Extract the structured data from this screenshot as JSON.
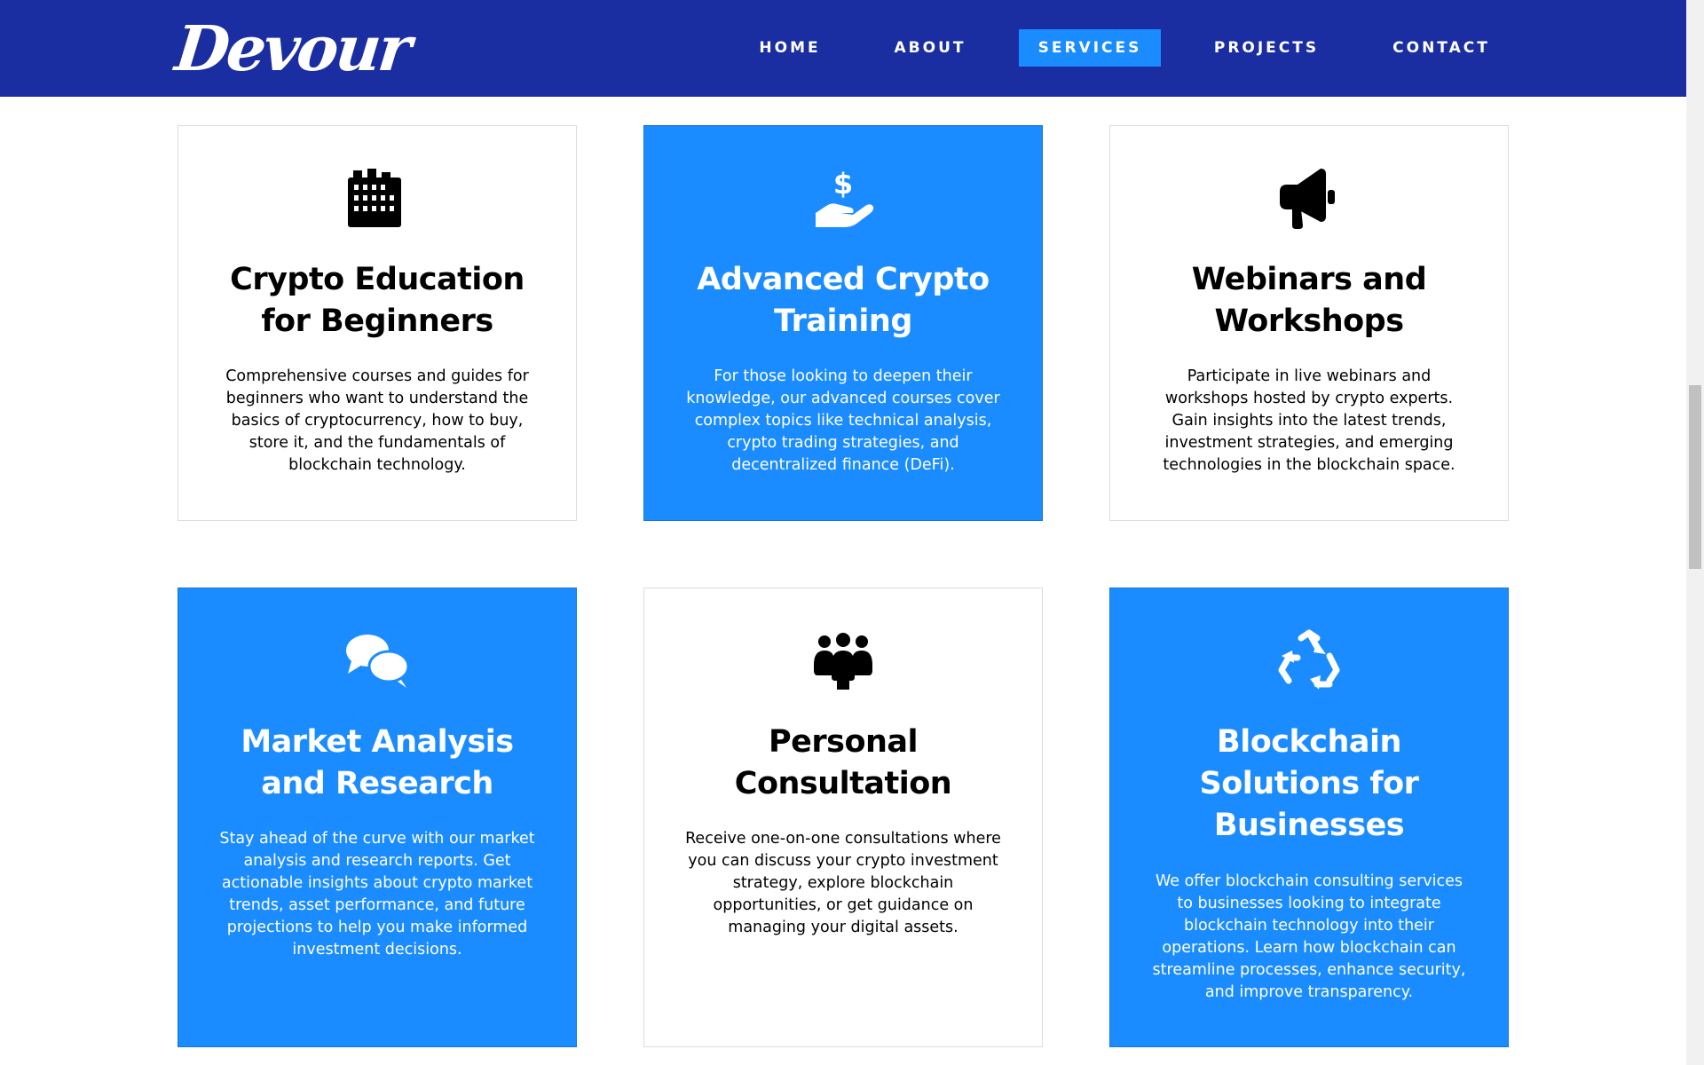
{
  "header": {
    "logo": "Devour",
    "nav": [
      "HOME",
      "ABOUT",
      "SERVICES",
      "PROJECTS",
      "CONTACT"
    ],
    "active_nav": "SERVICES"
  },
  "colors": {
    "header_bg": "#1a2ea1",
    "accent_blue": "#1a8cff",
    "card_border": "#dddddd"
  },
  "services": [
    {
      "icon": "building-icon",
      "title": "Crypto Education for Beginners",
      "description": "Comprehensive courses and guides for beginners who want to understand the basics of cryptocurrency, how to buy, store it, and the fundamentals of blockchain technology."
    },
    {
      "icon": "hand-dollar-icon",
      "title": "Advanced Crypto Training",
      "description": "For those looking to deepen their knowledge, our advanced courses cover complex topics like technical analysis, crypto trading strategies, and decentralized finance (DeFi)."
    },
    {
      "icon": "megaphone-icon",
      "title": "Webinars and Workshops",
      "description": "Participate in live webinars and workshops hosted by crypto experts. Gain insights into the latest trends, investment strategies, and emerging technologies in the blockchain space."
    },
    {
      "icon": "comments-icon",
      "title": "Market Analysis and Research",
      "description": "Stay ahead of the curve with our market analysis and research reports. Get actionable insights about crypto market trends, asset performance, and future projections to help you make informed investment decisions."
    },
    {
      "icon": "users-icon",
      "title": "Personal Consultation",
      "description": "Receive one-on-one consultations where you can discuss your crypto investment strategy, explore blockchain opportunities, or get guidance on managing your digital assets."
    },
    {
      "icon": "recycle-icon",
      "title": "Blockchain Solutions for Businesses",
      "description": "We offer blockchain consulting services to businesses looking to integrate blockchain technology into their operations. Learn how blockchain can streamline processes, enhance security, and improve transparency."
    }
  ]
}
